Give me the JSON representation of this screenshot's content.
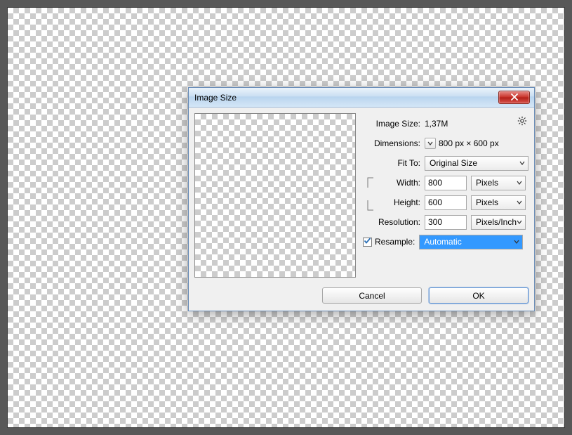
{
  "dialog": {
    "title": "Image Size",
    "image_size_label": "Image Size:",
    "image_size_value": "1,37M",
    "dimensions_label": "Dimensions:",
    "dimensions_value": "800 px  ×  600 px",
    "fit_to_label": "Fit To:",
    "fit_to_value": "Original Size",
    "width_label": "Width:",
    "width_value": "800",
    "width_unit": "Pixels",
    "height_label": "Height:",
    "height_value": "600",
    "height_unit": "Pixels",
    "resolution_label": "Resolution:",
    "resolution_value": "300",
    "resolution_unit": "Pixels/Inch",
    "resample_label": "Resample:",
    "resample_value": "Automatic",
    "cancel_label": "Cancel",
    "ok_label": "OK"
  }
}
